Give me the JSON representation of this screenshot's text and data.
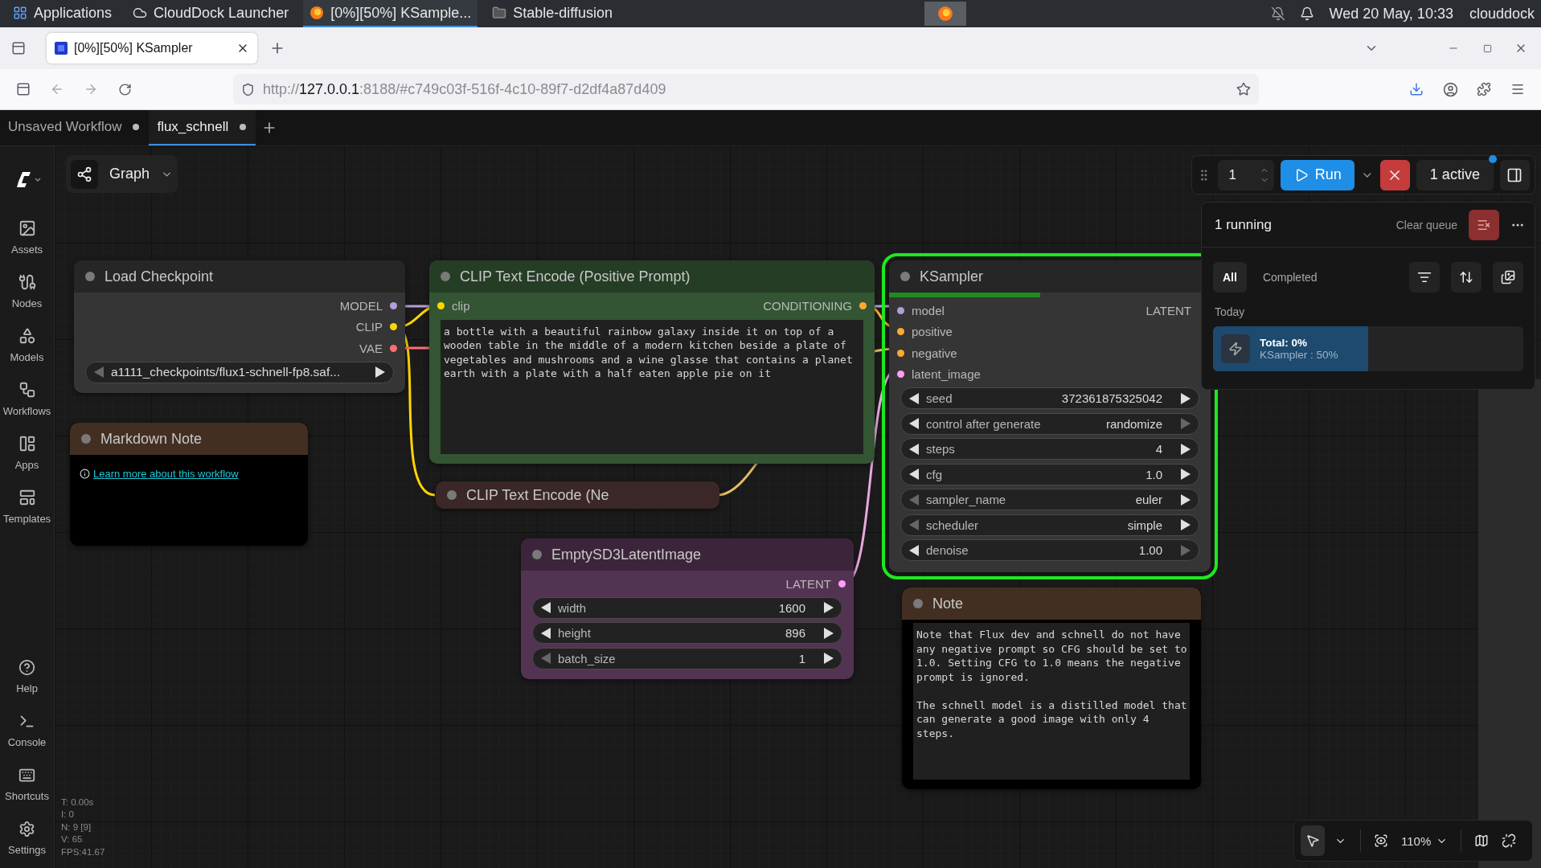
{
  "system_bar": {
    "menu": "Applications",
    "tasks": [
      {
        "label": "CloudDock Launcher",
        "selected": false
      },
      {
        "label": "[0%][50%] KSample...",
        "selected": true
      },
      {
        "label": "Stable-diffusion",
        "selected": false
      }
    ],
    "clock": "Wed 20 May, 10:33",
    "user": "clouddock"
  },
  "browser": {
    "tab_title": "[0%][50%] KSampler",
    "url_scheme": "http://",
    "url_host": "127.0.0.1",
    "url_rest": ":8188/#c749c03f-516f-4c10-89f7-d2df4a87d409"
  },
  "workflow_tabs": [
    {
      "label": "Unsaved Workflow",
      "selected": false,
      "modified": true
    },
    {
      "label": "flux_schnell",
      "selected": true,
      "modified": true
    }
  ],
  "sidebar": {
    "top": [
      {
        "label": "Assets"
      },
      {
        "label": "Nodes"
      },
      {
        "label": "Models"
      },
      {
        "label": "Workflows"
      },
      {
        "label": "Apps"
      },
      {
        "label": "Templates"
      }
    ],
    "bottom": [
      {
        "label": "Help"
      },
      {
        "label": "Console"
      },
      {
        "label": "Shortcuts"
      },
      {
        "label": "Settings"
      }
    ]
  },
  "graph_menu": "Graph",
  "run_bar": {
    "batch_count": "1",
    "run": "Run",
    "active": "1 active"
  },
  "queue": {
    "title": "1 running",
    "clear": "Clear queue",
    "filters": [
      {
        "label": "All",
        "selected": true
      },
      {
        "label": "Completed",
        "selected": false
      }
    ],
    "group": "Today",
    "job": {
      "total": "Total: 0%",
      "step": "KSampler : 50%",
      "level": 0.5
    }
  },
  "nodes": [
    {
      "kind": "standard",
      "title": "Load Checkpoint",
      "color": "#353535",
      "running": false,
      "outputs": [
        {
          "label": "MODEL",
          "color": "#b39ddb"
        },
        {
          "label": "CLIP",
          "color": "#ffd500"
        },
        {
          "label": "VAE",
          "color": "#ff6e6e"
        }
      ],
      "widgets": [
        {
          "value": "a1111_checkpoints/flux1-schnell-fp8.saf...",
          "dec_disabled": true,
          "inc_disabled": false
        }
      ]
    },
    {
      "kind": "standard",
      "title": "CLIP Text Encode (Positive Prompt)",
      "color": "#335533",
      "running": false,
      "inputs": [
        {
          "label": "clip",
          "color": "#ffd500"
        }
      ],
      "outputs": [
        {
          "label": "CONDITIONING",
          "color": "#ffa931"
        }
      ],
      "text": "a bottle with a beautiful rainbow galaxy inside it on top of a wooden table in the middle of a modern kitchen beside a plate of vegetables and mushrooms and a wine glasse that contains a planet earth with a plate with a half eaten apple pie on it"
    },
    {
      "kind": "standard",
      "title": "KSampler",
      "color": "#353535",
      "running": true,
      "level": 0.47,
      "inputs": [
        {
          "label": "model",
          "color": "#b39ddb"
        },
        {
          "label": "positive",
          "color": "#ffa931"
        },
        {
          "label": "negative",
          "color": "#ffa931"
        },
        {
          "label": "latent_image",
          "color": "#ff9cf9"
        }
      ],
      "outputs": [
        {
          "label": "LATENT"
        }
      ],
      "widgets": [
        {
          "label": "seed",
          "value": "372361875325042",
          "dec_disabled": false,
          "inc_disabled": false
        },
        {
          "label": "control after generate",
          "value": "randomize",
          "dec_disabled": false,
          "inc_disabled": true
        },
        {
          "label": "steps",
          "value": "4",
          "dec_disabled": false,
          "inc_disabled": false
        },
        {
          "label": "cfg",
          "value": "1.0",
          "dec_disabled": false,
          "inc_disabled": false
        },
        {
          "label": "sampler_name",
          "value": "euler",
          "dec_disabled": true,
          "inc_disabled": false
        },
        {
          "label": "scheduler",
          "value": "simple",
          "dec_disabled": true,
          "inc_disabled": false
        },
        {
          "label": "denoise",
          "value": "1.00",
          "dec_disabled": false,
          "inc_disabled": true
        }
      ]
    },
    {
      "kind": "markdown",
      "title": "Markdown Note",
      "color": "#432f21",
      "link": "Learn more about this workflow"
    },
    {
      "kind": "collapsed",
      "title": "CLIP Text Encode (Ne",
      "color": "#3b2727"
    },
    {
      "kind": "standard",
      "title": "EmptySD3LatentImage",
      "color": "#533352",
      "running": false,
      "outputs": [
        {
          "label": "LATENT",
          "color": "#ff9cf9"
        }
      ],
      "widgets": [
        {
          "label": "width",
          "value": "1600",
          "dec_disabled": false,
          "inc_disabled": false
        },
        {
          "label": "height",
          "value": "896",
          "dec_disabled": false,
          "inc_disabled": false
        },
        {
          "label": "batch_size",
          "value": "1",
          "dec_disabled": true,
          "inc_disabled": false
        }
      ]
    },
    {
      "kind": "note",
      "title": "Note",
      "color": "#432f21",
      "text": "Note that Flux dev and schnell do not have any negative prompt so CFG should be set to 1.0. Setting CFG to 1.0 means the negative prompt is ignored.\n\nThe schnell model is a distilled model that can generate a good image with only 4 steps."
    }
  ],
  "stats": [
    "T: 0.00s",
    "I: 0",
    "N: 9 [9]",
    "V: 65",
    "FPS:41.67"
  ],
  "canvas_toolbar": {
    "zoom": "110%"
  }
}
